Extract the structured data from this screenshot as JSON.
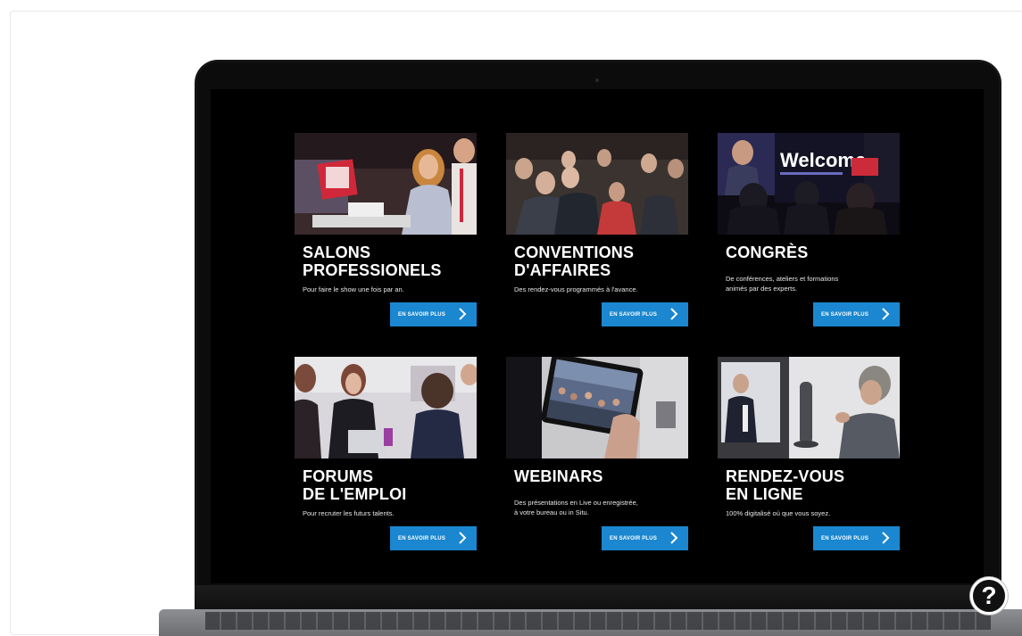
{
  "cards": [
    {
      "title": "SALONS\nPROFESSIONELS",
      "desc": "Pour faire le show une fois par an.",
      "cta": "EN SAVOIR PLUS",
      "photo_text": ""
    },
    {
      "title": "CONVENTIONS\nD'AFFAIRES",
      "desc": "Des rendez-vous programmés à l'avance.",
      "cta": "EN SAVOIR PLUS",
      "photo_text": ""
    },
    {
      "title": "CONGRÈS",
      "desc": "De conférences, ateliers et formations\nanimés par des experts.",
      "cta": "EN SAVOIR PLUS",
      "photo_text": "Welcome"
    },
    {
      "title": "FORUMS\nDE L'EMPLOI",
      "desc": "Pour recruter les futurs talents.",
      "cta": "EN SAVOIR PLUS",
      "photo_text": ""
    },
    {
      "title": "WEBINARS",
      "desc": "Des présentations en Live ou enregistrée,\nà votre bureau ou in Situ.",
      "cta": "EN SAVOIR PLUS",
      "photo_text": ""
    },
    {
      "title": "RENDEZ-VOUS\nEN LIGNE",
      "desc": "100% digitalisé où que vous soyez.",
      "cta": "EN SAVOIR PLUS",
      "photo_text": ""
    }
  ],
  "help_button": {
    "label": "?",
    "icon": "question-mark-icon"
  },
  "colors": {
    "accent": "#1a87d0",
    "screen_bg": "#000000"
  }
}
